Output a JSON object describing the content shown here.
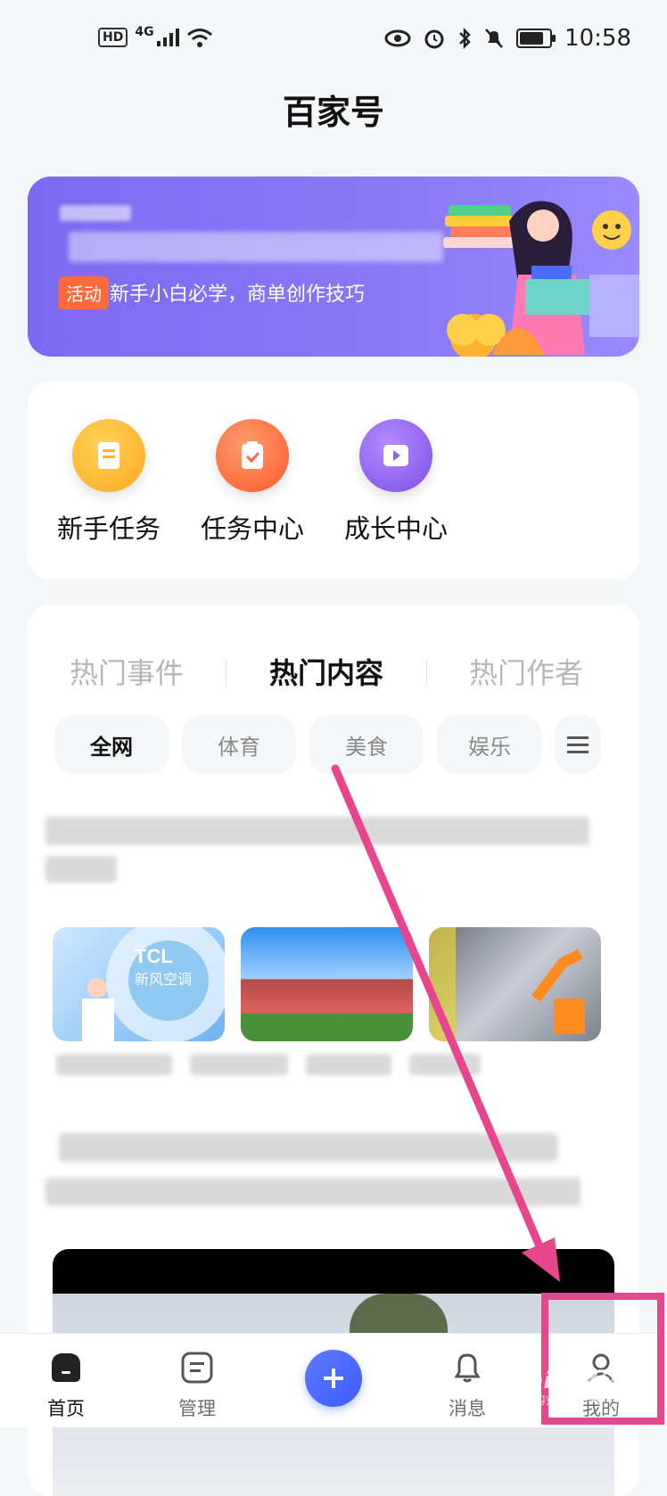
{
  "status": {
    "net": "4G",
    "hd": "HD",
    "time": "10:58"
  },
  "header": {
    "title": "百家号"
  },
  "banner": {
    "tag": "活动",
    "subtitle": "新手小白必学，商单创作技巧"
  },
  "quick": [
    {
      "label": "新手任务",
      "icon": "document-icon",
      "color": "#ffb22e"
    },
    {
      "label": "任务中心",
      "icon": "clipboard-check-icon",
      "color": "#ff6a3d"
    },
    {
      "label": "成长中心",
      "icon": "play-icon",
      "color": "#8c62f0"
    }
  ],
  "tabs": [
    "热门事件",
    "热门内容",
    "热门作者"
  ],
  "active_tab": "热门内容",
  "chips": [
    "全网",
    "体育",
    "美食",
    "娱乐"
  ],
  "thumbs": [
    {
      "text": "TCL\n新风空调"
    }
  ],
  "nav": [
    {
      "label": "首页"
    },
    {
      "label": "管理"
    },
    {
      "label": "消息"
    },
    {
      "label": "我的"
    }
  ],
  "watermark": {
    "line1": "Baidu经验",
    "line2": "jingyan.baidu.com"
  }
}
